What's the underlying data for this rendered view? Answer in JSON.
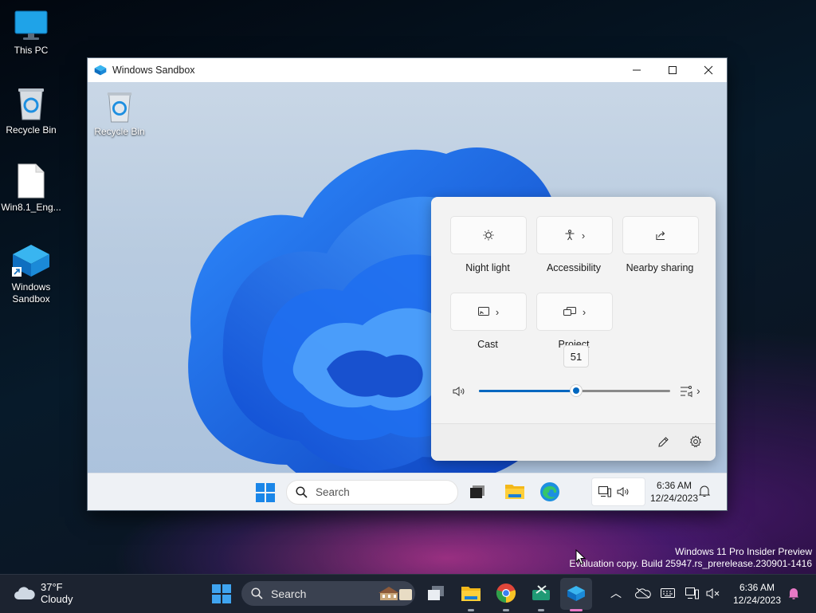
{
  "host_desktop": {
    "icons": [
      {
        "label": "This PC"
      },
      {
        "label": "Recycle Bin"
      },
      {
        "label": "Win8.1_Eng..."
      },
      {
        "label": "Windows Sandbox"
      }
    ]
  },
  "sandbox_window": {
    "title": "Windows Sandbox",
    "controls": {
      "minimize": "minimize-icon",
      "maximize": "maximize-icon",
      "close": "close-icon"
    },
    "guest_desktop": {
      "recycle_bin_label": "Recycle Bin"
    },
    "quick_settings": {
      "tiles": [
        {
          "label": "Night light",
          "icon": "night-light-icon",
          "has_chevron": false
        },
        {
          "label": "Accessibility",
          "icon": "accessibility-icon",
          "has_chevron": true
        },
        {
          "label": "Nearby sharing",
          "icon": "share-icon",
          "has_chevron": false
        },
        {
          "label": "Cast",
          "icon": "cast-icon",
          "has_chevron": true
        },
        {
          "label": "Project",
          "icon": "project-icon",
          "has_chevron": true
        }
      ],
      "volume": {
        "value": 51,
        "tooltip": "51"
      },
      "footer_icons": [
        "edit-icon",
        "settings-icon"
      ]
    },
    "guest_taskbar": {
      "search_placeholder": "Search",
      "time": "6:36 AM",
      "date": "12/24/2023"
    }
  },
  "watermark": {
    "line1": "Windows 11 Pro Insider Preview",
    "line2": "Evaluation copy. Build 25947.rs_prerelease.230901-1416"
  },
  "host_taskbar": {
    "weather": {
      "temp": "37°F",
      "condition": "Cloudy"
    },
    "search_placeholder": "Search",
    "time": "6:36 AM",
    "date": "12/24/2023"
  },
  "colors": {
    "accent": "#0067c0",
    "qs_background": "#f3f3f3",
    "host_taskbar": "#1c2330"
  }
}
